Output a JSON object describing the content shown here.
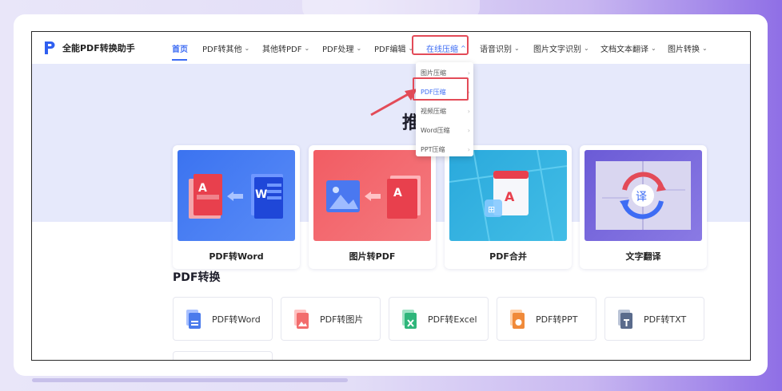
{
  "app": {
    "title": "全能PDF转换助手"
  },
  "nav": {
    "items": [
      {
        "label": "首页",
        "chevron": false
      },
      {
        "label": "PDF转其他",
        "chevron": true
      },
      {
        "label": "其他转PDF",
        "chevron": true
      },
      {
        "label": "PDF处理",
        "chevron": true
      },
      {
        "label": "PDF编辑",
        "chevron": true
      },
      {
        "label": "在线压缩",
        "chevron": true
      },
      {
        "label": "语音识别",
        "chevron": true
      },
      {
        "label": "图片文字识别",
        "chevron": true
      },
      {
        "label": "文档文本翻译",
        "chevron": true
      },
      {
        "label": "图片转换",
        "chevron": true
      }
    ],
    "active_index": 0,
    "open_index": 5
  },
  "dropdown": {
    "items": [
      {
        "label": "图片压缩"
      },
      {
        "label": "PDF压缩"
      },
      {
        "label": "视频压缩"
      },
      {
        "label": "Word压缩"
      },
      {
        "label": "PPT压缩"
      }
    ],
    "selected_index": 1
  },
  "hero": {
    "title_partial": "推"
  },
  "feature_cards": [
    {
      "label": "PDF转Word"
    },
    {
      "label": "图片转PDF"
    },
    {
      "label": "PDF合并"
    },
    {
      "label": "文字翻译"
    }
  ],
  "translate_glyph": "译",
  "section": {
    "title": "PDF转换"
  },
  "tools": [
    {
      "label": "PDF转Word",
      "icon": "word-doc-icon",
      "color": "#4b7bec"
    },
    {
      "label": "PDF转图片",
      "icon": "image-doc-icon",
      "color": "#f26d6d"
    },
    {
      "label": "PDF转Excel",
      "icon": "excel-doc-icon",
      "color": "#2fb67b"
    },
    {
      "label": "PDF转PPT",
      "icon": "ppt-doc-icon",
      "color": "#f08a3a"
    },
    {
      "label": "PDF转TXT",
      "icon": "txt-doc-icon",
      "color": "#5a6b8c"
    }
  ],
  "colors": {
    "accent": "#3d6cf4",
    "highlight_red": "#e34b58",
    "hero_bg": "#e6e9fb"
  }
}
